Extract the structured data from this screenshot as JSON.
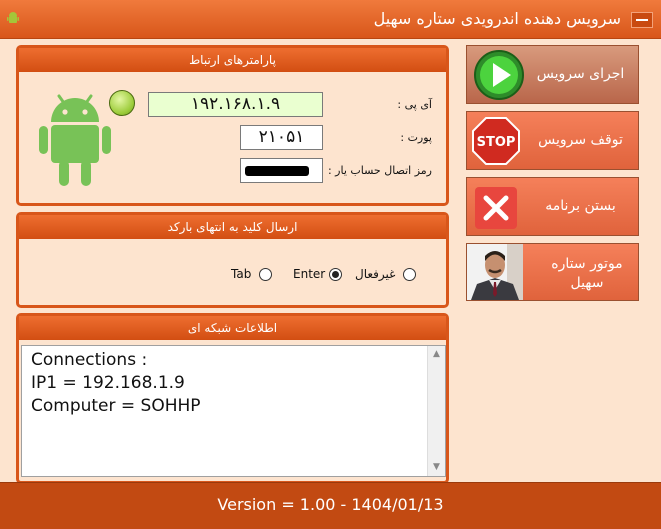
{
  "window": {
    "title": "سرویس دهنده اندرویدی ستاره سهیل"
  },
  "connection": {
    "header": "پارامترهای ارتباط",
    "ip_label": "آی پی :",
    "ip_value": "۱۹۲.۱۶۸.۱.۹",
    "port_label": "پورت :",
    "port_value": "۲۱۰۵۱",
    "password_label": "رمز اتصال حساب یار :",
    "status_led_color": "#9ccc3a"
  },
  "send_key": {
    "header": "ارسال کلید به انتهای بارکد",
    "options": [
      {
        "label": "غیرفعال",
        "selected": false
      },
      {
        "label": "Enter",
        "selected": true
      },
      {
        "label": "Tab",
        "selected": false
      }
    ]
  },
  "network": {
    "header": "اطلاعات شبکه ای",
    "lines": [
      "Connections :",
      "IP1 = 192.168.1.9",
      "Computer = SOHHP"
    ]
  },
  "buttons": {
    "start": "اجرای سرویس",
    "stop": "توقف سرویس",
    "close": "بستن برنامه",
    "engine": "موتور ستاره سهیل",
    "stop_sign_text": "STOP"
  },
  "footer": {
    "version": "Version = 1.00 - 1404/01/13"
  },
  "colors": {
    "accent": "#d8561a",
    "background": "#fde4cf",
    "footer": "#c24a12"
  }
}
